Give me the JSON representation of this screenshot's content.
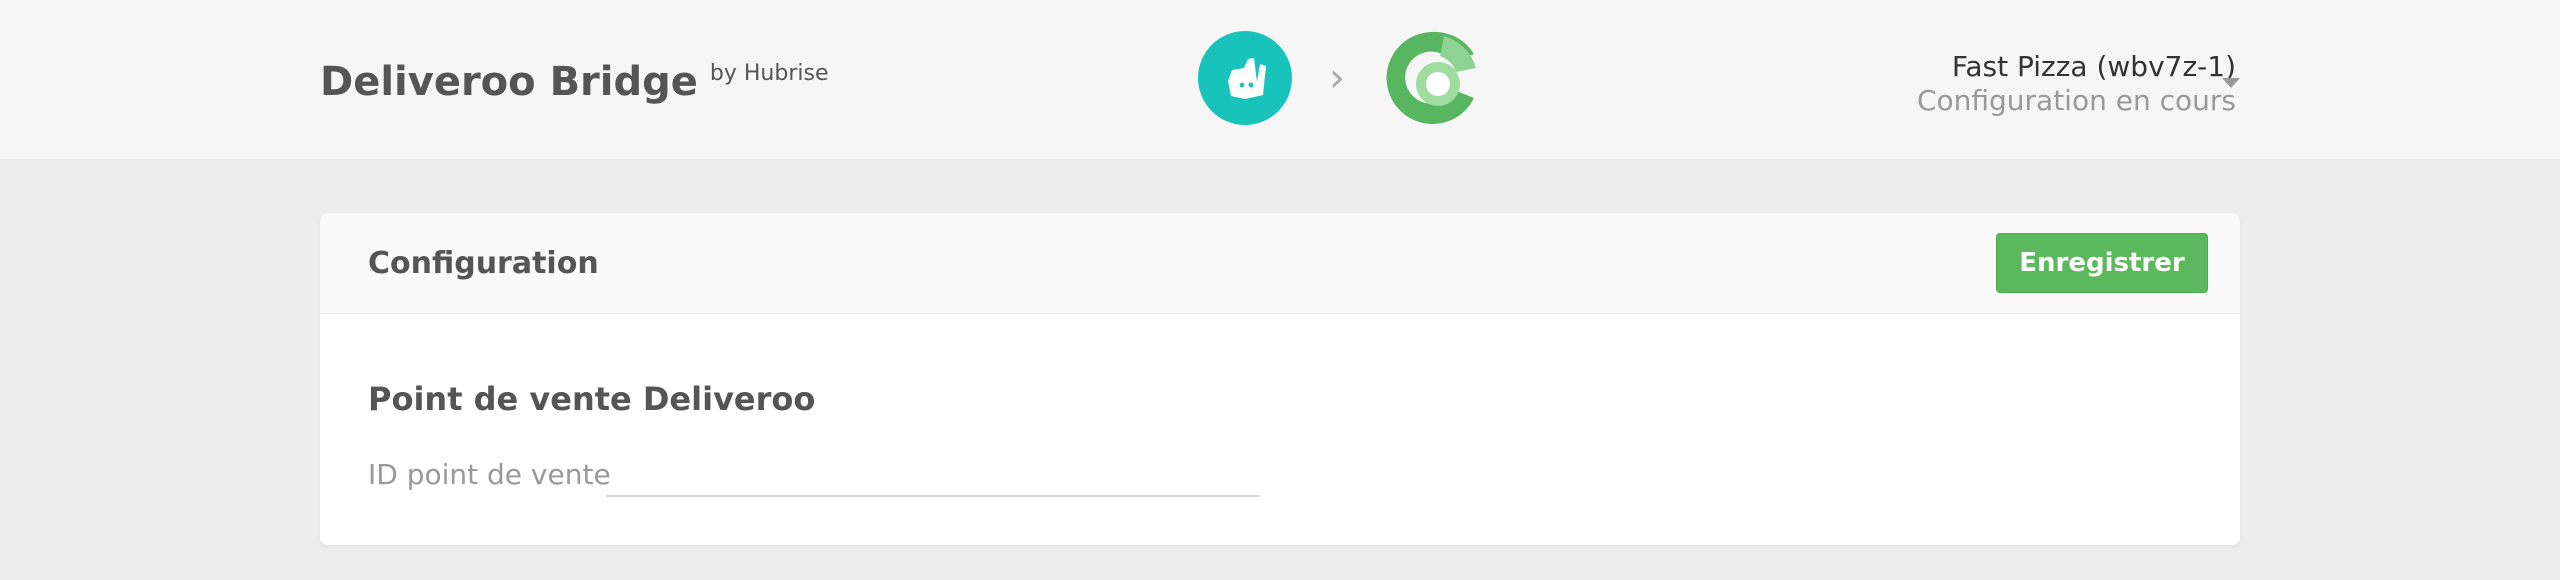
{
  "header": {
    "app_title": "Deliveroo Bridge",
    "app_subtitle": "by Hubrise",
    "flow": {
      "source_icon": "deliveroo-logo-icon",
      "arrow": "›",
      "target_icon": "hubrise-logo-icon"
    },
    "account": {
      "name": "Fast Pizza (wbv7z-1)",
      "status": "Configuration en cours",
      "dropdown_icon": "caret-down-icon"
    }
  },
  "card": {
    "title": "Configuration",
    "save_label": "Enregistrer",
    "section_title": "Point de vente Deliveroo",
    "field_label": "ID point de vente",
    "field_value": "",
    "field_placeholder": ""
  },
  "colors": {
    "deliveroo_teal": "#18c3bc",
    "save_green": "#5cb85c",
    "hubrise_green_dark": "#57b65f",
    "hubrise_green_light": "#8fd392"
  }
}
